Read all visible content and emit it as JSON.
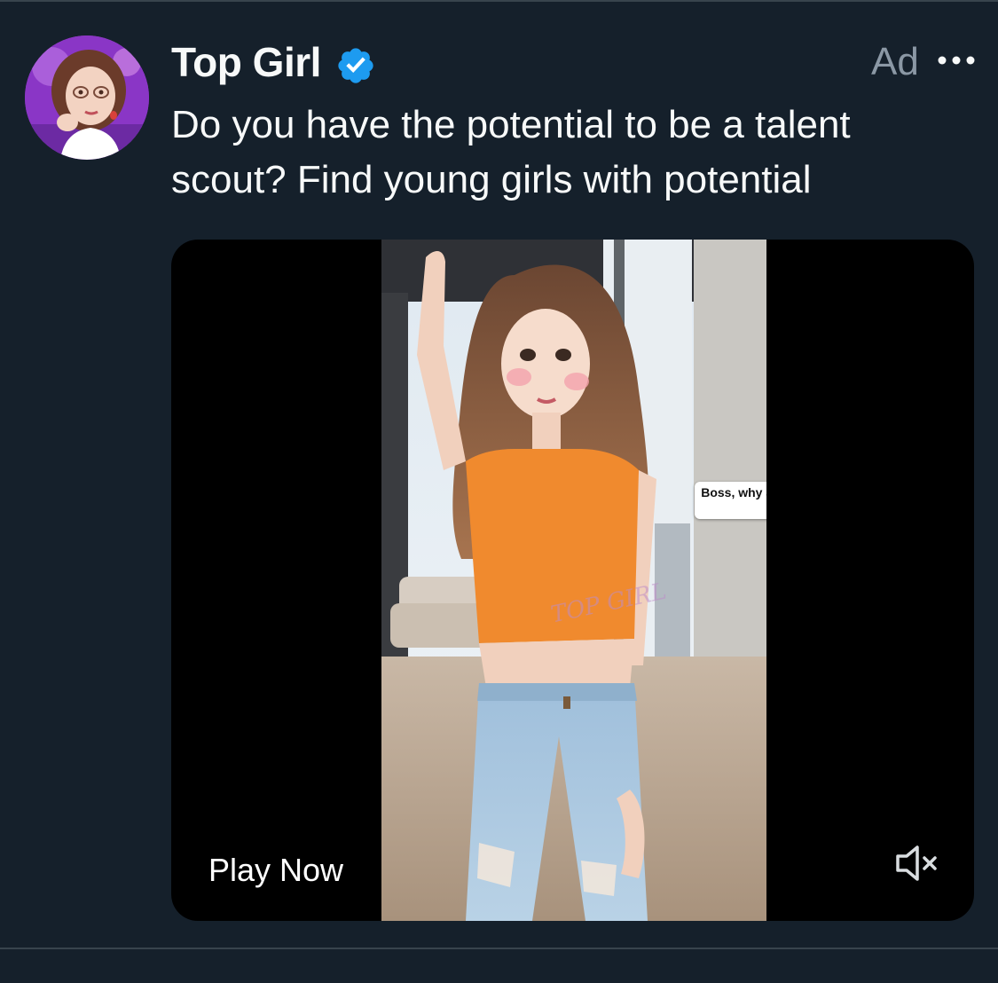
{
  "post": {
    "author_name": "Top Girl",
    "ad_label": "Ad",
    "text": "Do you have the potential to be a talent scout? Find young girls with potential",
    "verified": true
  },
  "icons": {
    "avatar": "profile-avatar",
    "verified": "verified-badge-icon",
    "more": "more-options-icon",
    "mute": "speaker-muted-icon"
  },
  "media": {
    "caption_bubble": "Boss, why are you waiting for me?",
    "watermark": "TOP GIRL",
    "cta_label": "Play Now"
  },
  "colors": {
    "background": "#15202b",
    "text_primary": "#f7f9f9",
    "text_secondary": "#8b98a5",
    "verified_blue": "#1d9bf0",
    "divider": "#38444d"
  }
}
